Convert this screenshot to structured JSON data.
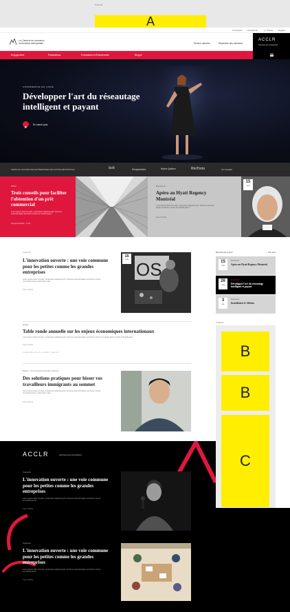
{
  "ads": {
    "top_label": "Publicité",
    "a": "A",
    "side_label": "Publicité",
    "b1": "B",
    "b2": "B",
    "c": "C"
  },
  "utility": {
    "connexion": "Connexion",
    "recherche": "Recherche",
    "panier": "Panier",
    "langue": "English"
  },
  "header": {
    "logo_line1": "La Chambre de commerce",
    "logo_line2": "du Montréal métropolitain",
    "devenir_membre": "Devenir membre",
    "repertoire": "Répertoire des membres",
    "acclr": "ACCLR",
    "acclr_sub": "Services aux entreprises"
  },
  "nav": [
    "Engagement",
    "Publications",
    "Formations et Événements",
    "Blogue"
  ],
  "hero": {
    "kicker": "CONFÉRENCE EN LIGNE",
    "title": "Développer l'art du réseautage intelligent et payant",
    "cta": "En savoir plus"
  },
  "partners": {
    "label": "FIERS DU SUCCÈS DES ENTREPRISES DE NOTRE MÉTROPOLE :",
    "logos": [
      "BeR",
      "Desjardins",
      "Hydro Québec",
      "RioTinto",
      "Air Canada"
    ]
  },
  "features": {
    "red": {
      "kicker": "Article",
      "title": "Trois conseils pour faciliter l'obtention d'un prêt commercial",
      "desc": "Lorem ipsum dolor sit amet, consectetur adipiscing elit. Vivamus euismod sapien sed lorem cursus non iaculis ipsum.",
      "meta": "Temps de lecture · 3 min"
    },
    "gray": {
      "kicker": "Événement",
      "title": "Apéro au Hyatt Regency Montréal",
      "desc": "Lorem ipsum dolor sit amet, consectetur adipiscing elit. Vivamus euismod sapien sed lorem cursus non iaculis ipsum.",
      "meta": "Type d'article",
      "date_day": "15",
      "date_month": "JUIN"
    }
  },
  "articles": [
    {
      "kicker": "Concours",
      "title": "L'innovation ouverte : une voie commune pour les petites comme les grandes entreprises",
      "desc": "Lorem ipsum dolor sit amet, consectetur adipiscing elit. Vivamus euismod sapien sed lorem cursus non iaculis ipsum, elementum vitae.",
      "meta": "Type d'article",
      "date_day": "15",
      "date_month": "JUIN"
    },
    {
      "kicker": "Blogue",
      "title": "Table ronde annuelle sur les enjeux économiques internationaux",
      "desc": "Lorem ipsum dolor sit amet, consectetur adipiscing elit. Vivamus euismod sapien sed lorem cursus non iaculis ipsum. Fusce id fringilla dolor.",
      "meta": "Type d'article",
      "tags": "POUR ALLER PLUS LOIN · CONTENU · 3 MAI 2019"
    },
    {
      "kicker": "Blogue · Communiqué partenaire national",
      "title": "Des solutions pratiques pour hisser vos travailleurs immigrants au sommet",
      "desc": "Lorem ipsum dolor sit amet, consectetur adipiscing elit. Vivamus euismod sapien sed lorem cursus non iaculis ipsum, elementum vitae.",
      "meta": "Type d'article"
    }
  ],
  "events": {
    "heading": "Événements à venir",
    "all": "Voir tous",
    "items": [
      {
        "day": "15",
        "month": "JUIN",
        "kicker": "Événement",
        "title": "Apéro au Hyatt Regency Montréal"
      },
      {
        "day": "26",
        "month": "JUIN",
        "kicker": "Événement",
        "title": "Développer l'art du réseautage intelligent et payant"
      },
      {
        "day": "3",
        "month": "JUIL",
        "kicker": "Événement",
        "title": "Installation 5e Sélénia"
      }
    ]
  },
  "acclr_section": {
    "logo": "ACCLR",
    "sub": "Services aux entreprises",
    "items": [
      {
        "kicker": "Concours",
        "title": "L'innovation ouverte : une voie commune pour les petites comme les grandes entreprises",
        "desc": "Lorem ipsum dolor sit amet, consectetur adipiscing elit. Vivamus euismod sapien sed lorem cursus non iaculis ipsum.",
        "meta": "Type d'article"
      },
      {
        "kicker": "Concours",
        "title": "L'innovation ouverte : une voie commune pour les petites comme les grandes entreprises",
        "desc": "Lorem ipsum dolor sit amet, consectetur adipiscing elit. Vivamus euismod sapien sed lorem cursus non iaculis ipsum.",
        "meta": "Type d'article"
      }
    ]
  },
  "colors": {
    "brand_red": "#e0173d",
    "ad_yellow": "#ffee00",
    "black": "#000000"
  }
}
